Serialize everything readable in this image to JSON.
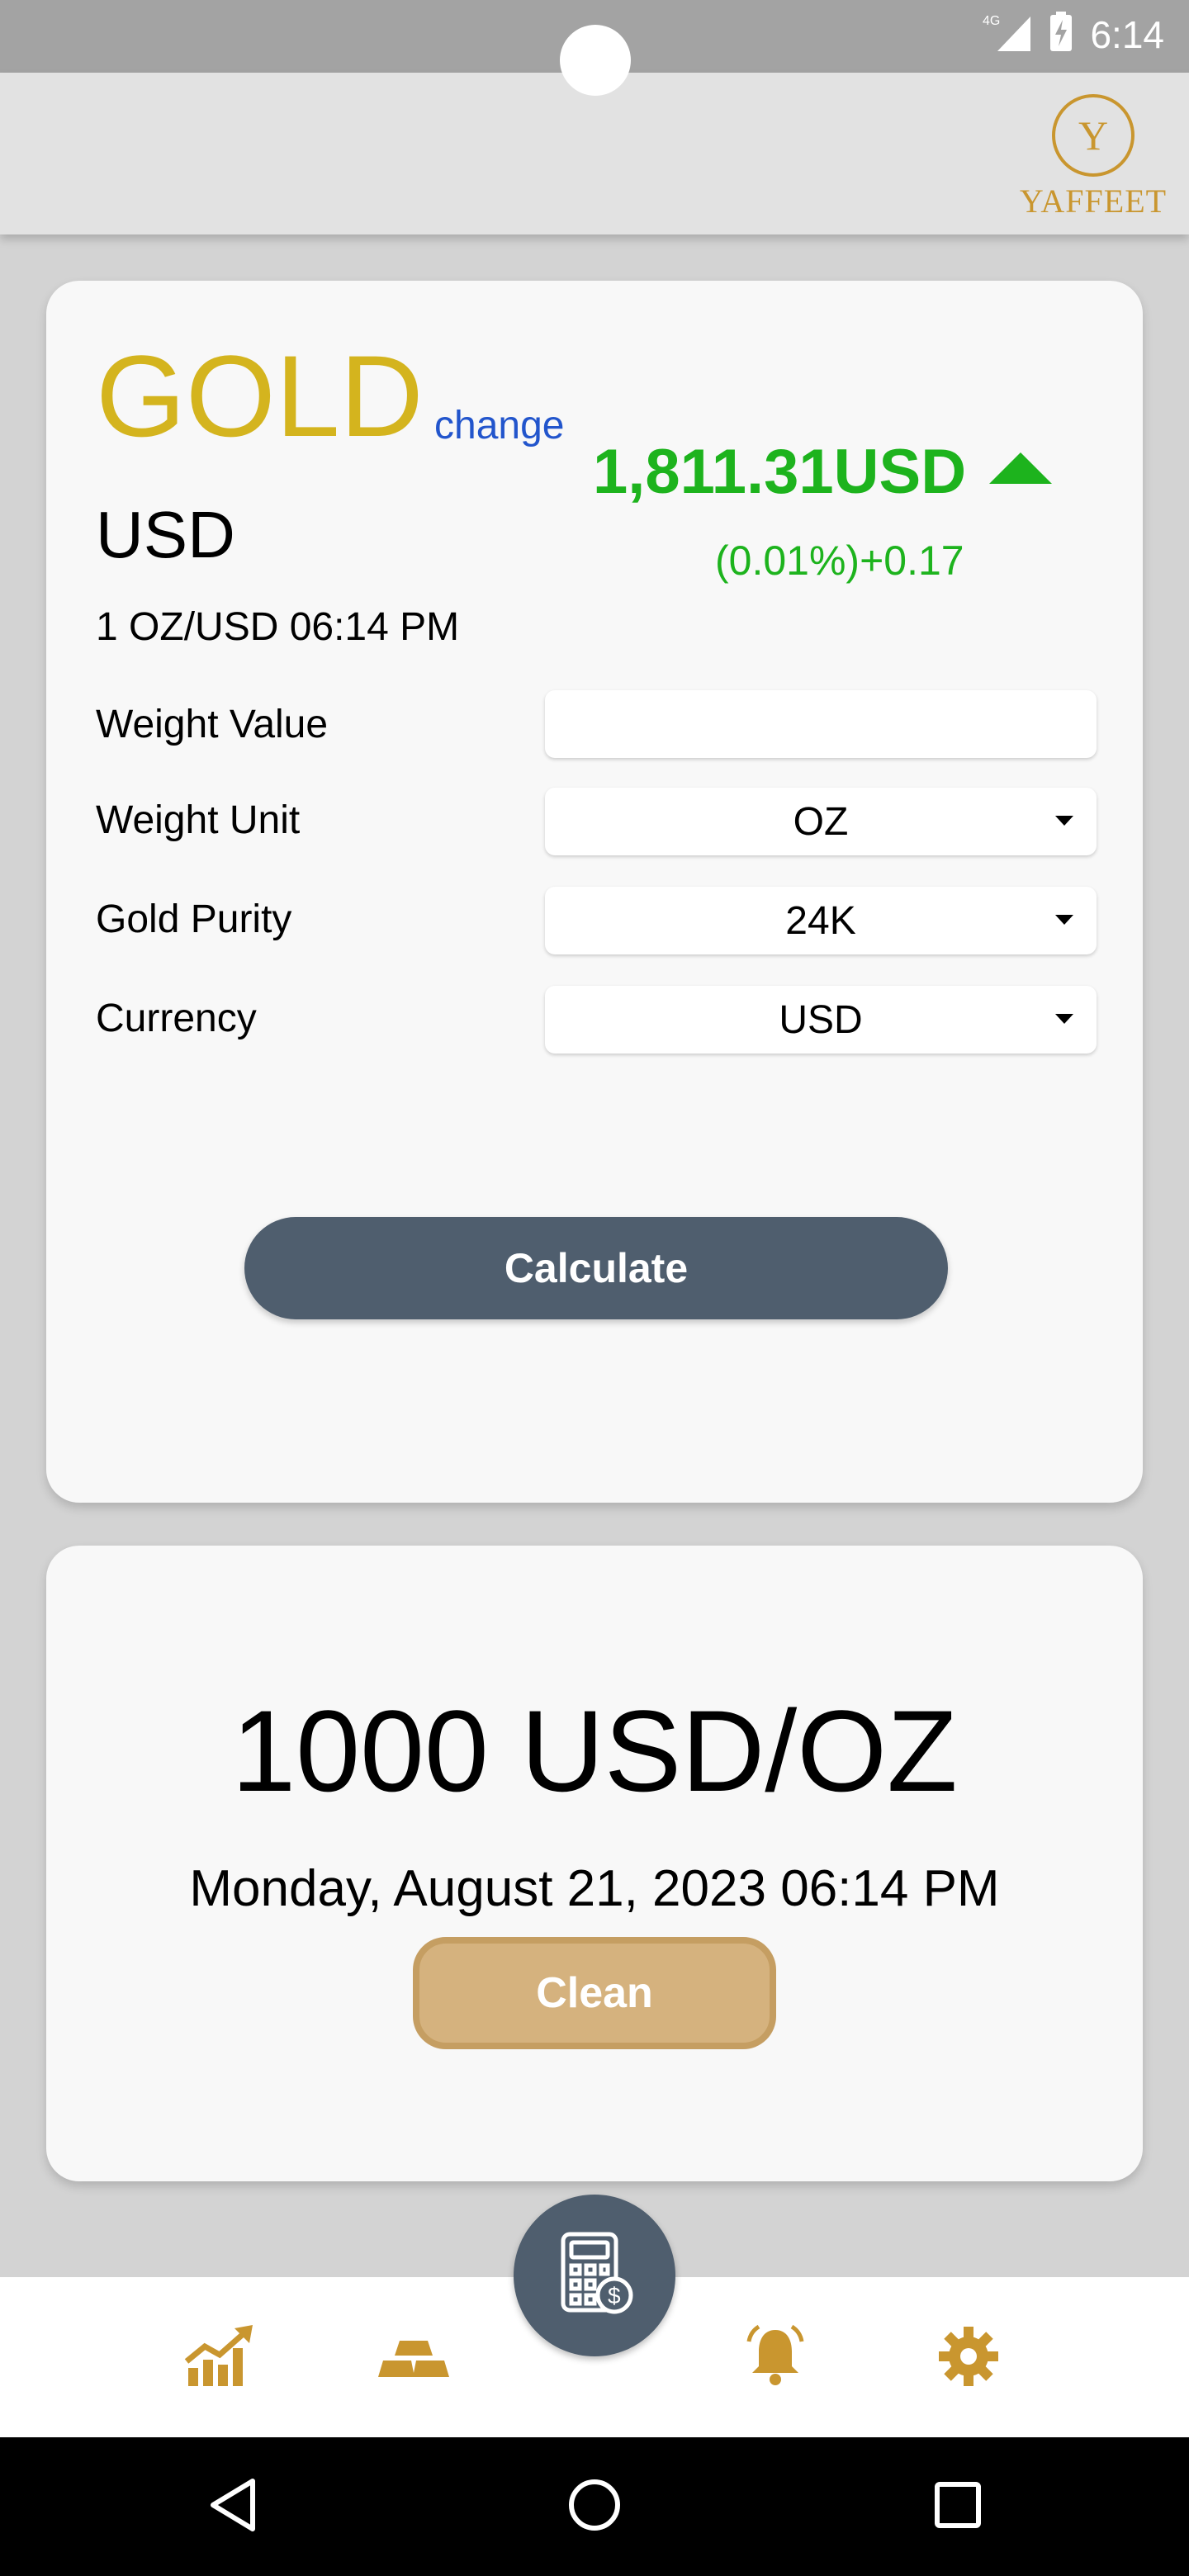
{
  "status_bar": {
    "time": "6:14",
    "network": "4G"
  },
  "app": {
    "logo_text": "YAFFEET"
  },
  "gold_card": {
    "metal": "GOLD",
    "change_link": "change",
    "currency": "USD",
    "unit_time": "1 OZ/USD 06:14 PM",
    "price": "1,811.31USD",
    "change": "(0.01%)+0.17",
    "trend": "up"
  },
  "form": {
    "weight_value_label": "Weight Value",
    "weight_value": "",
    "weight_unit_label": "Weight Unit",
    "weight_unit": "OZ",
    "purity_label": "Gold Purity",
    "purity": "24K",
    "currency_label": "Currency",
    "currency": "USD",
    "calculate": "Calculate"
  },
  "result_card": {
    "result": "1000 USD/OZ",
    "date": "Monday, August 21, 2023 06:14 PM",
    "clean": "Clean"
  },
  "colors": {
    "gold_text": "#d4b41e",
    "price_green": "#1db31d",
    "link_blue": "#2255cc",
    "button_slate": "#4f5e6e",
    "clean_tan": "#d5b27e",
    "nav_icon": "#c9962f"
  },
  "bottom_nav": {
    "items": [
      "chart-icon",
      "gold-bars-icon",
      "calculator-icon",
      "bell-icon",
      "gear-icon"
    ]
  }
}
